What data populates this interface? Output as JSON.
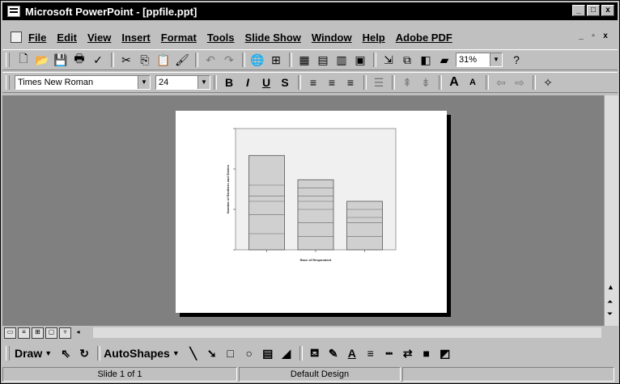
{
  "window": {
    "title": "Microsoft PowerPoint - [ppfile.ppt]",
    "controls": [
      "_",
      "□",
      "x"
    ]
  },
  "menu": {
    "items": [
      "File",
      "Edit",
      "View",
      "Insert",
      "Format",
      "Tools",
      "Slide Show",
      "Window",
      "Help",
      "Adobe PDF"
    ],
    "doc_controls": [
      "_",
      "▫",
      "x"
    ]
  },
  "standard_toolbar": {
    "zoom": "31%"
  },
  "formatting_toolbar": {
    "font": "Times New Roman",
    "size": "24",
    "bold": "B",
    "italic": "I",
    "underline": "U",
    "shadow": "S"
  },
  "chart_data": {
    "type": "bar",
    "categories": [
      "",
      "",
      ""
    ],
    "values": [
      3.5,
      2.6,
      1.8
    ],
    "ylim": [
      0,
      4.5
    ],
    "xlabel": "Race of Respondent",
    "ylabel": "Number of Brothers and Sisters",
    "grid": false,
    "inner_lines": [
      [
        0.6,
        1.3,
        1.8,
        2.0,
        2.4
      ],
      [
        0.5,
        1.0,
        1.5,
        1.8,
        2.0,
        2.3
      ],
      [
        0.5,
        1.0,
        1.2,
        1.5
      ]
    ]
  },
  "draw_toolbar": {
    "draw": "Draw",
    "autoshapes": "AutoShapes"
  },
  "status": {
    "slide": "Slide 1 of 1",
    "design": "Default Design"
  }
}
